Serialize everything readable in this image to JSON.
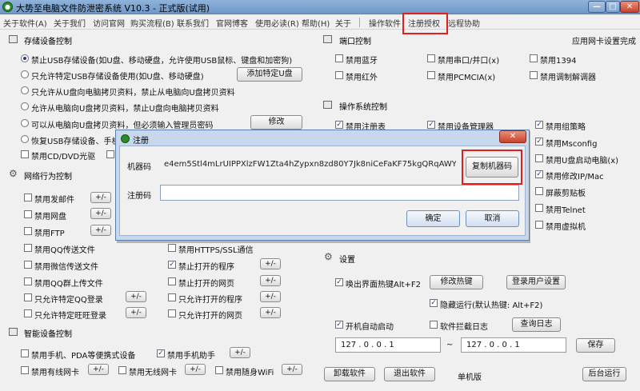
{
  "window": {
    "title": "大势至电脑文件防泄密系统 V10.3 - 正式版(试用)",
    "min": "—",
    "max": "□",
    "close": "✕"
  },
  "menu": [
    "关于软件(A)",
    "关于我们",
    "访问官网",
    "购买流程(B)",
    "联系我们",
    "官网博客",
    "使用必读(R)",
    "帮助(H)",
    "关于",
    "操作软件",
    "注册授权",
    "远程协助"
  ],
  "storage": {
    "title": "存储设备控制",
    "options": [
      "禁止USB存储设备(如U盘、移动硬盘，允许使用USB鼠标、键盘和加密狗)",
      "只允许特定USB存储设备使用(如U盘、移动硬盘)",
      "只允许从U盘向电脑拷贝资料，禁止从电脑向U盘拷贝资料",
      "允许从电脑向U盘拷贝资料，禁止U盘向电脑拷贝资料",
      "可以从电脑向U盘拷贝资料，但必须输入管理员密码",
      "恢复USB存储设备、手机"
    ],
    "add_udisk": "添加特定U盘",
    "modify": "修改",
    "cd_dvd": "禁用CD/DVD光驱"
  },
  "network": {
    "title": "网络行为控制",
    "left_items": [
      "禁用发邮件",
      "禁用网盘",
      "禁用FTP",
      "禁用QQ传送文件",
      "禁用微信传送文件",
      "禁用QQ群上传文件",
      "只允许特定QQ登录",
      "只允许特定旺旺登录"
    ],
    "right_items": [
      "禁用HTTPS/SSL通信",
      "禁止打开的程序",
      "禁止打开的网页",
      "只允许打开的程序",
      "只允许打开的网页"
    ],
    "pm": "+/-"
  },
  "smart": {
    "title": "智能设备控制",
    "items": [
      "禁用手机、PDA等便携式设备",
      "禁用手机助手",
      "禁用有线网卡",
      "禁用无线网卡",
      "禁用随身WiFi"
    ],
    "pm": "+/-"
  },
  "port": {
    "title": "端口控制",
    "apply_status": "应用网卡设置完成",
    "items": [
      "禁用蓝牙",
      "禁用串口/并口(x)",
      "禁用1394",
      "禁用红外",
      "禁用PCMCIA(x)",
      "禁用调制解调器"
    ]
  },
  "os": {
    "title": "操作系统控制",
    "items": [
      "禁用注册表",
      "禁用设备管理器",
      "禁用组策略",
      "禁用Msconfig",
      "禁用U盘启动电脑(x)",
      "禁用修改IP/Mac",
      "屏蔽剪贴板",
      "禁用Telnet",
      "禁用虚拟机"
    ]
  },
  "settings": {
    "title": "设置",
    "hotkey_label": "唤出界面热键Alt+F2",
    "modify_hotkey": "修改热键",
    "login_user": "登录用户设置",
    "hide_run": "隐藏运行(默认热键: Alt+F2)",
    "autostart": "开机自动启动",
    "intercept_log": "软件拦截日志",
    "view_log": "查询日志",
    "ip_from": "127 .  0  .  0  .  1",
    "tilde": "~",
    "ip_to": "127 .  0  .  0  .  1",
    "save": "保存",
    "uninstall": "卸载软件",
    "exit": "退出软件",
    "edition": "单机版",
    "background": "后台运行"
  },
  "dialog": {
    "title": "注册",
    "close": "✕",
    "machine_code_label": "机器码",
    "machine_code": "e4em5Stl4mLrUIPPXlzFW1Zta4hZypxn8zd80Y7Jk8niCeFaKF75kgQRqAWYRXpKEd/...",
    "copy_button": "复制机器码",
    "reg_code_label": "注册码",
    "reg_code_value": "",
    "ok": "确定",
    "cancel": "取消"
  }
}
